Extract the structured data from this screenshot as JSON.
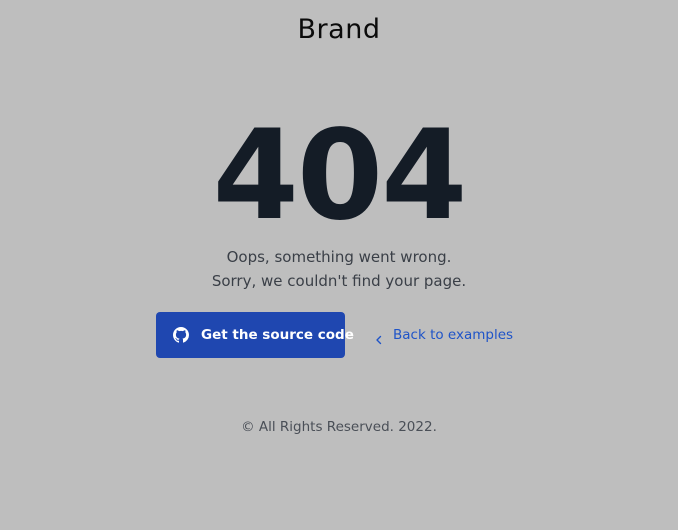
{
  "header": {
    "brand": "Brand"
  },
  "error": {
    "code": "404",
    "message_line1": "Oops, something went wrong.",
    "message_line2": "Sorry, we couldn't find your page."
  },
  "actions": {
    "source_button": {
      "label": "Get the source code",
      "icon": "github-icon"
    },
    "back_link": {
      "label": "Back to examples",
      "icon": "chevron-left-icon"
    }
  },
  "footer": {
    "copyright": "© All Rights Reserved. 2022."
  },
  "colors": {
    "background": "#bebebe",
    "primary": "#1f47b0",
    "link": "#1f54c8",
    "heading": "#141c26"
  }
}
